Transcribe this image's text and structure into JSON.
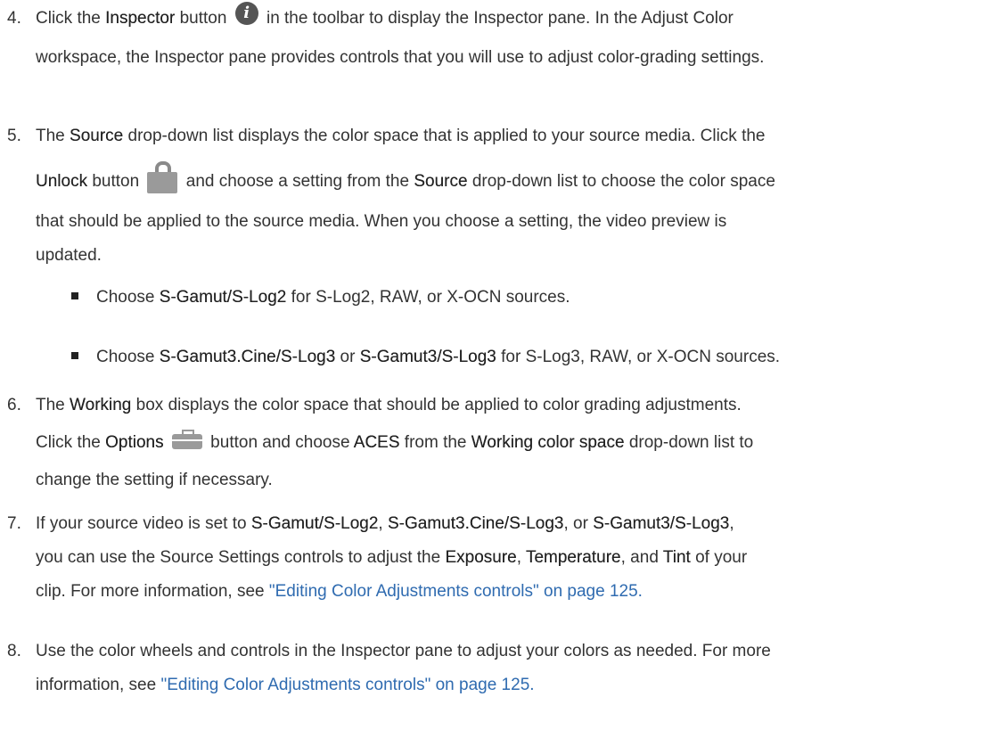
{
  "steps": {
    "s4": {
      "num": "4.",
      "l1_a": "Click the ",
      "l1_term": "Inspector",
      "l1_b": " button ",
      "l1_c": " in the toolbar to display the Inspector pane. In the Adjust Color",
      "l2": "workspace, the Inspector pane provides controls that you will use to adjust color-grading settings."
    },
    "s5": {
      "num": "5.",
      "l1_a": "The ",
      "l1_term": "Source",
      "l1_b": " drop-down list displays the color space that is applied to your source media. Click the",
      "l2_term": "Unlock",
      "l2_a": " button ",
      "l2_b": " and choose a setting from the ",
      "l2_term2": "Source",
      "l2_c": " drop-down list to choose the color space",
      "l3": "that should be applied to the source media. When you choose a setting, the video preview is",
      "l4": "updated.",
      "bullets": [
        {
          "a": "Choose ",
          "t1": "S-Gamut/S-Log2",
          "b": " for S-Log2, RAW, or X-OCN sources.",
          "t2": "",
          "c": ""
        },
        {
          "a": "Choose ",
          "t1": "S-Gamut3.Cine/S-Log3",
          "b": " or ",
          "t2": "S-Gamut3/S-Log3",
          "c": " for S-Log3, RAW, or X-OCN sources."
        }
      ]
    },
    "s6": {
      "num": "6.",
      "l1_a": "The ",
      "l1_term": "Working",
      "l1_b": "  box displays the color space that should be applied to color grading adjustments.",
      "l2_a": "Click the ",
      "l2_term": "Options",
      "l2_b": " button and choose ",
      "l2_term2": "ACES",
      "l2_c": " from the ",
      "l2_term3": "Working color space",
      "l2_d": " drop-down list to",
      "l3": "change the setting if necessary."
    },
    "s7": {
      "num": "7.",
      "l1_a": "If your source video is set to ",
      "l1_t1": "S-Gamut/S-Log2",
      "l1_b": ", ",
      "l1_t2": "S-Gamut3.Cine/S-Log3",
      "l1_c": ", or ",
      "l1_t3": "S-Gamut3/S-Log3",
      "l1_d": ",",
      "l2_a": "you can use the Source Settings controls to adjust the ",
      "l2_t1": "Exposure",
      "l2_b": ", ",
      "l2_t2": "Temperature",
      "l2_c": ", and ",
      "l2_t3": "Tint",
      "l2_d": " of your",
      "l3_a": "clip. For more information, see ",
      "l3_link": "\"Editing Color Adjustments controls\" on page 125."
    },
    "s8": {
      "num": "8.",
      "l1": "Use the color wheels and controls in the Inspector pane to adjust your colors as needed. For more",
      "l2_a": "information, see ",
      "l2_link": "\"Editing Color Adjustments controls\" on page 125."
    }
  },
  "icons": {
    "inspector": "info-icon",
    "unlock": "lock-icon",
    "options": "toolbox-icon"
  },
  "colors": {
    "text": "#333333",
    "link": "#2f6bb0",
    "icon": "#9a9a9a"
  }
}
